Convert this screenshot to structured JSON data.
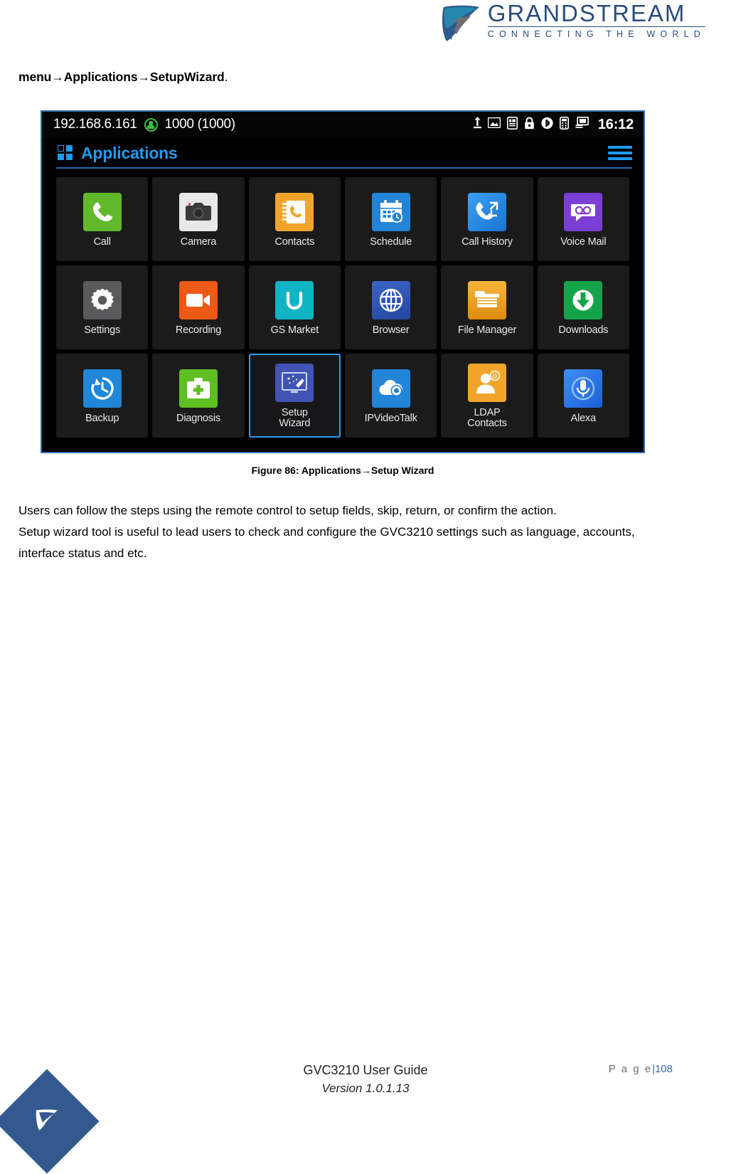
{
  "header": {
    "brand": "GRANDSTREAM",
    "tagline": "CONNECTING THE WORLD",
    "logo_color": "#2a4d80"
  },
  "intro": {
    "part1": "menu",
    "arrow1": "→",
    "part2": "Applications",
    "arrow2": "→",
    "part3": "SetupWizard",
    "period": "."
  },
  "device": {
    "status_bar": {
      "ip_address": "192.168.6.161",
      "account": "1000 (1000)",
      "time": "16:12",
      "icons": [
        "upload-icon",
        "screenshot-icon",
        "sd-card-icon",
        "lock-icon",
        "bluetooth-icon",
        "remote-control-icon",
        "hdmi-display-icon"
      ]
    },
    "title": "Applications",
    "title_color": "#1e9bf0",
    "menu_icon": "hamburger-menu-icon",
    "apps": [
      {
        "label": "Call",
        "icon": "call-icon",
        "color": "#62b92c",
        "selected": false
      },
      {
        "label": "Camera",
        "icon": "camera-icon",
        "color": "#e6e6e6",
        "selected": false
      },
      {
        "label": "Contacts",
        "icon": "contacts-icon",
        "color": "#f0a52a",
        "selected": false
      },
      {
        "label": "Schedule",
        "icon": "schedule-icon",
        "color": "#2184d6",
        "selected": false
      },
      {
        "label": "Call History",
        "icon": "call-history-icon",
        "color": "#2196f3",
        "selected": false
      },
      {
        "label": "Voice Mail",
        "icon": "voice-mail-icon",
        "color": "#7c3fd6",
        "selected": false
      },
      {
        "label": "Settings",
        "icon": "settings-icon",
        "color": "#5a5a5c",
        "selected": false
      },
      {
        "label": "Recording",
        "icon": "recording-icon",
        "color": "#ec5a16",
        "selected": false
      },
      {
        "label": "GS Market",
        "icon": "gs-market-icon",
        "color": "#11b4c4",
        "selected": false
      },
      {
        "label": "Browser",
        "icon": "browser-icon",
        "color": "#2b52ad",
        "selected": false
      },
      {
        "label": "File Manager",
        "icon": "file-manager-icon",
        "color": "#f0a81e",
        "selected": false
      },
      {
        "label": "Downloads",
        "icon": "downloads-icon",
        "color": "#16a44a",
        "selected": false
      },
      {
        "label": "Backup",
        "icon": "backup-icon",
        "color": "#2086d8",
        "selected": false
      },
      {
        "label": "Diagnosis",
        "icon": "diagnosis-icon",
        "color": "#5fbe22",
        "selected": false
      },
      {
        "label": "Setup\nWizard",
        "icon": "setup-wizard-icon",
        "color": "#4154b5",
        "selected": true
      },
      {
        "label": "IPVideoTalk",
        "icon": "ipvideotalk-icon",
        "color": "#2384d8",
        "selected": false
      },
      {
        "label": "LDAP\nContacts",
        "icon": "ldap-contacts-icon",
        "color": "#f0a52a",
        "selected": false
      },
      {
        "label": "Alexa",
        "icon": "alexa-icon",
        "color": "#2a7ef0",
        "selected": false
      }
    ]
  },
  "figure": {
    "caption_prefix": "Figure 86: Applications",
    "caption_arrow": "→",
    "caption_suffix": "Setup Wizard"
  },
  "body": {
    "paragraph1": "Users can follow the steps using the remote control to setup fields, skip, return, or confirm the action.",
    "paragraph2": "Setup wizard tool is useful to lead users to check and configure the GVC3210 settings such as language, accounts, interface status and etc."
  },
  "footer": {
    "title": "GVC3210 User Guide",
    "version": "Version 1.0.1.13",
    "page_label": "P a g e",
    "page_number": "|108",
    "diamond_color": "#34598f"
  }
}
